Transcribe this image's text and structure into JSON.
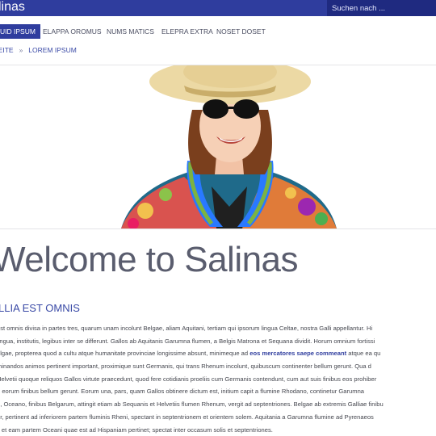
{
  "header": {
    "title": "linas",
    "search_placeholder": "Suchen nach ..."
  },
  "nav": {
    "items": [
      {
        "label": "UID IPSUM",
        "active": true
      },
      {
        "label": "ELAPPA OROMUS",
        "active": false
      },
      {
        "label": "NUMS MATICS",
        "active": false
      },
      {
        "label": "ELEPRA EXTRA",
        "active": false
      },
      {
        "label": "NOSET DOSET",
        "active": false
      }
    ]
  },
  "breadcrumb": {
    "items": [
      "SEITE",
      "LOREM IPSUM"
    ],
    "separator": "»"
  },
  "hero": {
    "subject": "smiling woman with straw hat, sunglasses and flower lei"
  },
  "main": {
    "heading": "Welcome to Salinas",
    "subheading": "LLIA EST OMNIS",
    "lines": [
      "est omnis divisa in partes tres, quarum unam incolunt Belgae, aliam Aquitani, tertiam qui ipsorum lingua Celtae, nostra Galli appellantur. Hi",
      "lingua, institutis, legibus inter se differunt. Gallos ab Aquitanis Garumna flumen, a Belgis Matrona et Sequana dividit. Horum omnium fortissi",
      "elgae, propterea quod a cultu atque humanitate provinciae longissime absunt, minimeque ad",
      "minandos animos pertinent important, proximique sunt Germanis, qui trans Rhenum incolunt, quibuscum continenter bellum gerunt. Qua d",
      "Helvetii quoque reliquos Gallos virtute praecedunt, quod fere cotidianis proeliis cum Germanis contendunt, cum aut suis finibus eos prohiber",
      "n eorum finibus bellum gerunt. Eorum una, pars, quam Gallos obtinere dictum est, initium capit a flumine Rhodano, continetur Garumna",
      "e, Oceano, finibus Belgarum, attingit etiam ab Sequanis et Helvetiis flumen Rhenum, vergit ad septentriones. Belgae ab extremis Galliae finibu",
      "ur, pertinent ad inferiorem partem fluminis Rheni, spectant in septentrionem et orientem solem. Aquitania a Garumna flumine ad Pyrenaeos",
      "s et eam partem Oceani quae est ad Hispaniam pertinet; spectat inter occasum solis et septentriones."
    ],
    "line3_bold": "eos mercatores saepe commeant",
    "line3_tail": " atque ea qu"
  },
  "colors": {
    "primary": "#2f3d9e",
    "link": "#3a4aa6",
    "text": "#45474f"
  }
}
